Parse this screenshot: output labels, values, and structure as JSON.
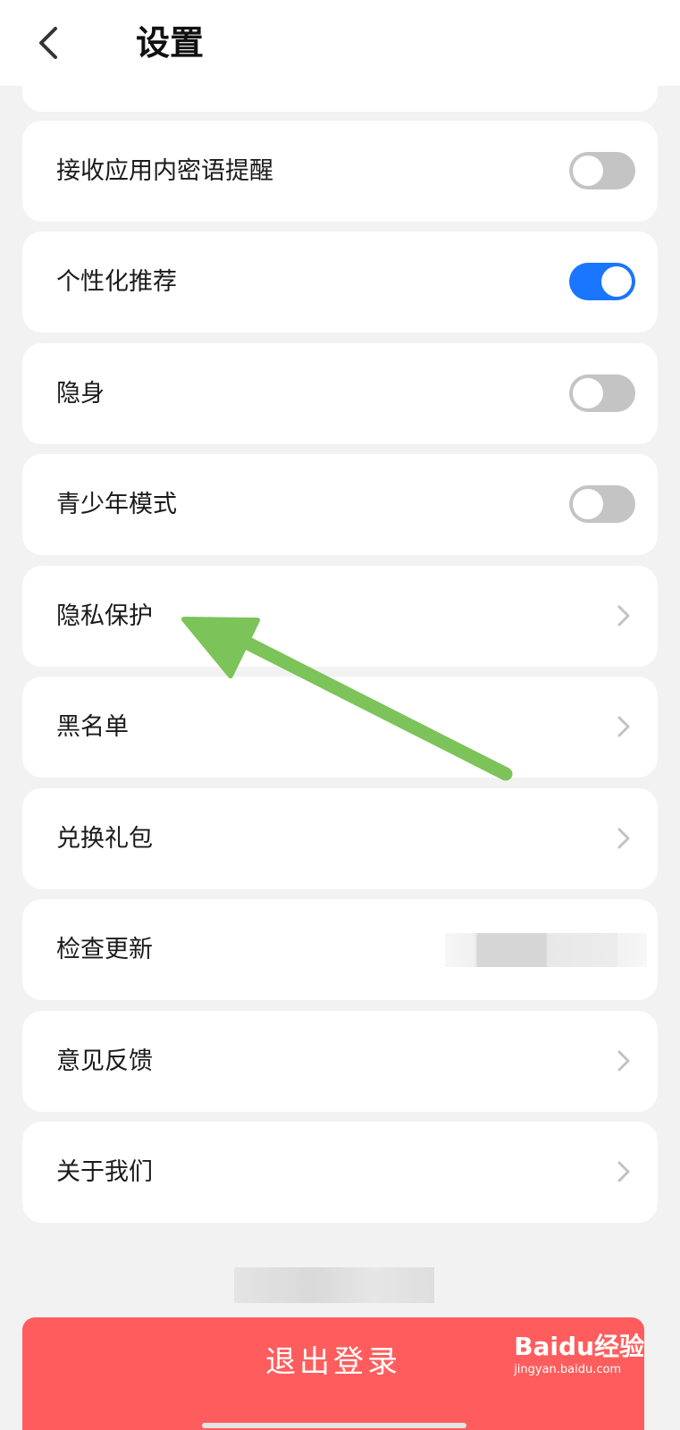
{
  "header": {
    "title": "设置"
  },
  "settings": [
    {
      "label": "接收应用内密语提醒",
      "control": "toggle",
      "on": false
    },
    {
      "label": "个性化推荐",
      "control": "toggle",
      "on": true
    },
    {
      "label": "隐身",
      "control": "toggle",
      "on": false
    },
    {
      "label": "青少年模式",
      "control": "toggle",
      "on": false
    },
    {
      "label": "隐私保护",
      "control": "chevron"
    },
    {
      "label": "黑名单",
      "control": "chevron"
    },
    {
      "label": "兑换礼包",
      "control": "chevron"
    },
    {
      "label": "检查更新",
      "control": "value-redacted"
    },
    {
      "label": "意见反馈",
      "control": "chevron"
    },
    {
      "label": "关于我们",
      "control": "chevron"
    }
  ],
  "logout": {
    "label": "退出登录"
  },
  "watermark": {
    "brand": "Baidu经验",
    "url": "jingyan.baidu.com"
  },
  "colors": {
    "accent": "#1a75ff",
    "toggle_off": "#c4c4c4",
    "logout": "#ff5d5d",
    "annotation_arrow": "#7cc35a",
    "background": "#f2f2f2"
  },
  "icons": {
    "back": "chevron-left-icon",
    "row": "chevron-right-icon",
    "annotation": "arrow-icon"
  }
}
